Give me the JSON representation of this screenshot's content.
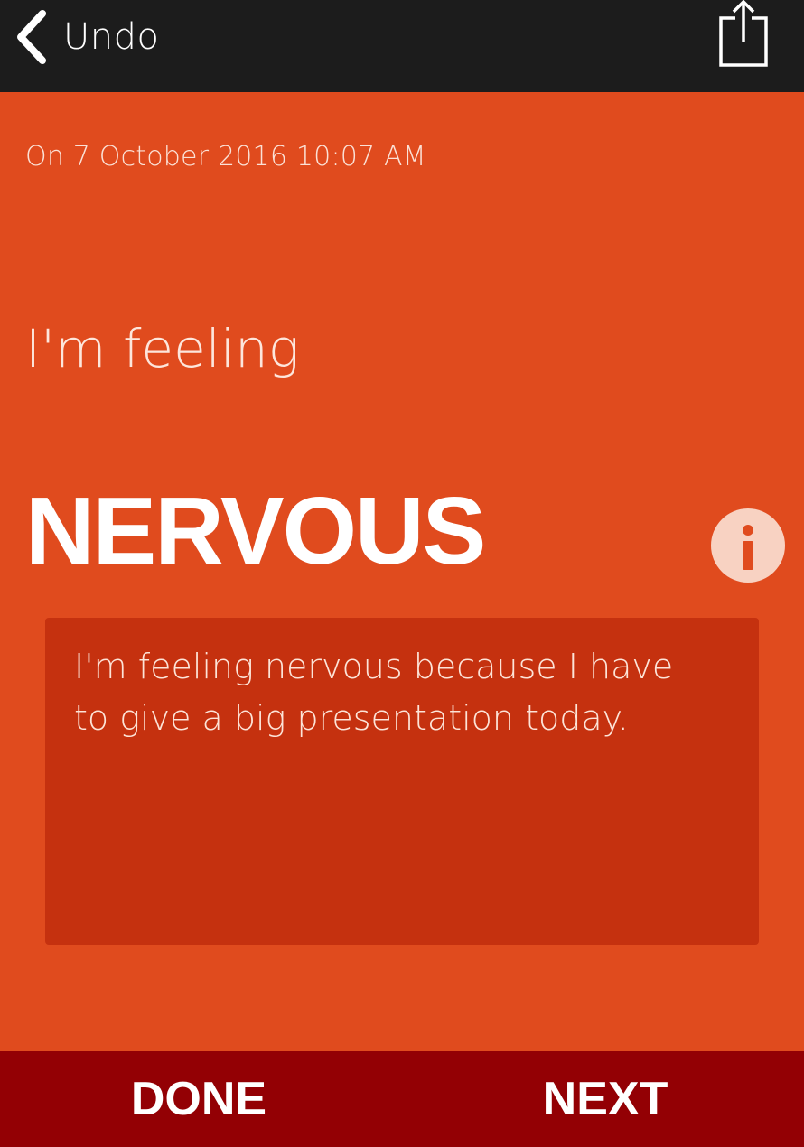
{
  "topbar": {
    "back_label": "Undo",
    "back_icon": "chevron-left-icon",
    "share_icon": "share-icon"
  },
  "entry": {
    "date": "On 7 October 2016 10:07 AM",
    "prefix": "I'm feeling",
    "emotion": "NERVOUS",
    "info_icon": "info-icon",
    "note": "I'm feeling nervous because I have to give a big presentation today."
  },
  "footer": {
    "done_label": "DONE",
    "next_label": "NEXT"
  },
  "colors": {
    "background": "#e04b1e",
    "topbar": "#1c1c1c",
    "note_box": "#c5310f",
    "bottombar": "#930004",
    "info_circle": "#f8d2c2"
  }
}
